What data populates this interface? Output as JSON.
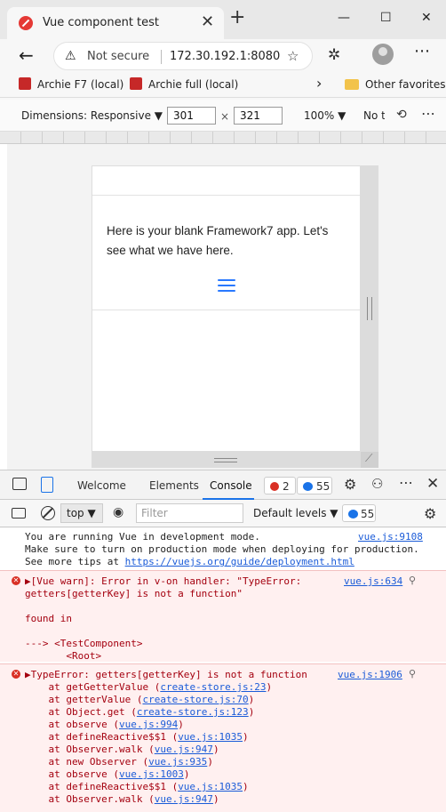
{
  "browser": {
    "tab_title": "Vue component test",
    "tab_close": "✕",
    "new_tab": "+",
    "min": "—",
    "max": "☐",
    "close": "✕",
    "back": "←",
    "not_secure": "Not secure",
    "url": "172.30.192.1:8080",
    "bookmarks": [
      "Archie F7 (local)",
      "Archie full (local)"
    ],
    "other_favorites": "Other favorites",
    "more": "⋯"
  },
  "emulation": {
    "dimensions": "Dimensions: Responsive ▼",
    "width": "301",
    "times": "×",
    "height": "321",
    "zoom": "100% ▼",
    "throttle": "No throttling"
  },
  "app": {
    "text": "Here is your blank Framework7 app. Let's see what we have here."
  },
  "devtools": {
    "tabs": [
      "Welcome",
      "Elements",
      "Console"
    ],
    "error_count": "2",
    "message_count": "55",
    "context": "top ▼",
    "filter_placeholder": "Filter",
    "levels": "Default levels ▼"
  },
  "console": {
    "info_lines": [
      "You are running Vue in development mode.",
      "Make sure to turn on production mode when deploying for production.",
      "See more tips at "
    ],
    "info_link": "https://vuejs.org/guide/deployment.html",
    "info_src": "vue.js:9108",
    "warn_lines": [
      "▶[Vue warn]: Error in v-on handler: \"TypeError:",
      "getters[getterKey] is not a function\"",
      "",
      "found in",
      "",
      "---> <TestComponent>",
      "       <Root>"
    ],
    "warn_src": "vue.js:634",
    "error_head": "▶TypeError: getters[getterKey] is not a function",
    "error_src": "vue.js:1906",
    "stack": [
      {
        "fn": "    at getGetterValue (",
        "loc": "create-store.js:23",
        "end": ")"
      },
      {
        "fn": "    at getterValue (",
        "loc": "create-store.js:70",
        "end": ")"
      },
      {
        "fn": "    at Object.get (",
        "loc": "create-store.js:123",
        "end": ")"
      },
      {
        "fn": "    at observe (",
        "loc": "vue.js:994",
        "end": ")"
      },
      {
        "fn": "    at defineReactive$$1 (",
        "loc": "vue.js:1035",
        "end": ")"
      },
      {
        "fn": "    at Observer.walk (",
        "loc": "vue.js:947",
        "end": ")"
      },
      {
        "fn": "    at new Observer (",
        "loc": "vue.js:935",
        "end": ")"
      },
      {
        "fn": "    at observe (",
        "loc": "vue.js:1003",
        "end": ")"
      },
      {
        "fn": "    at defineReactive$$1 (",
        "loc": "vue.js:1035",
        "end": ")"
      },
      {
        "fn": "    at Observer.walk (",
        "loc": "vue.js:947",
        "end": ")"
      }
    ]
  }
}
